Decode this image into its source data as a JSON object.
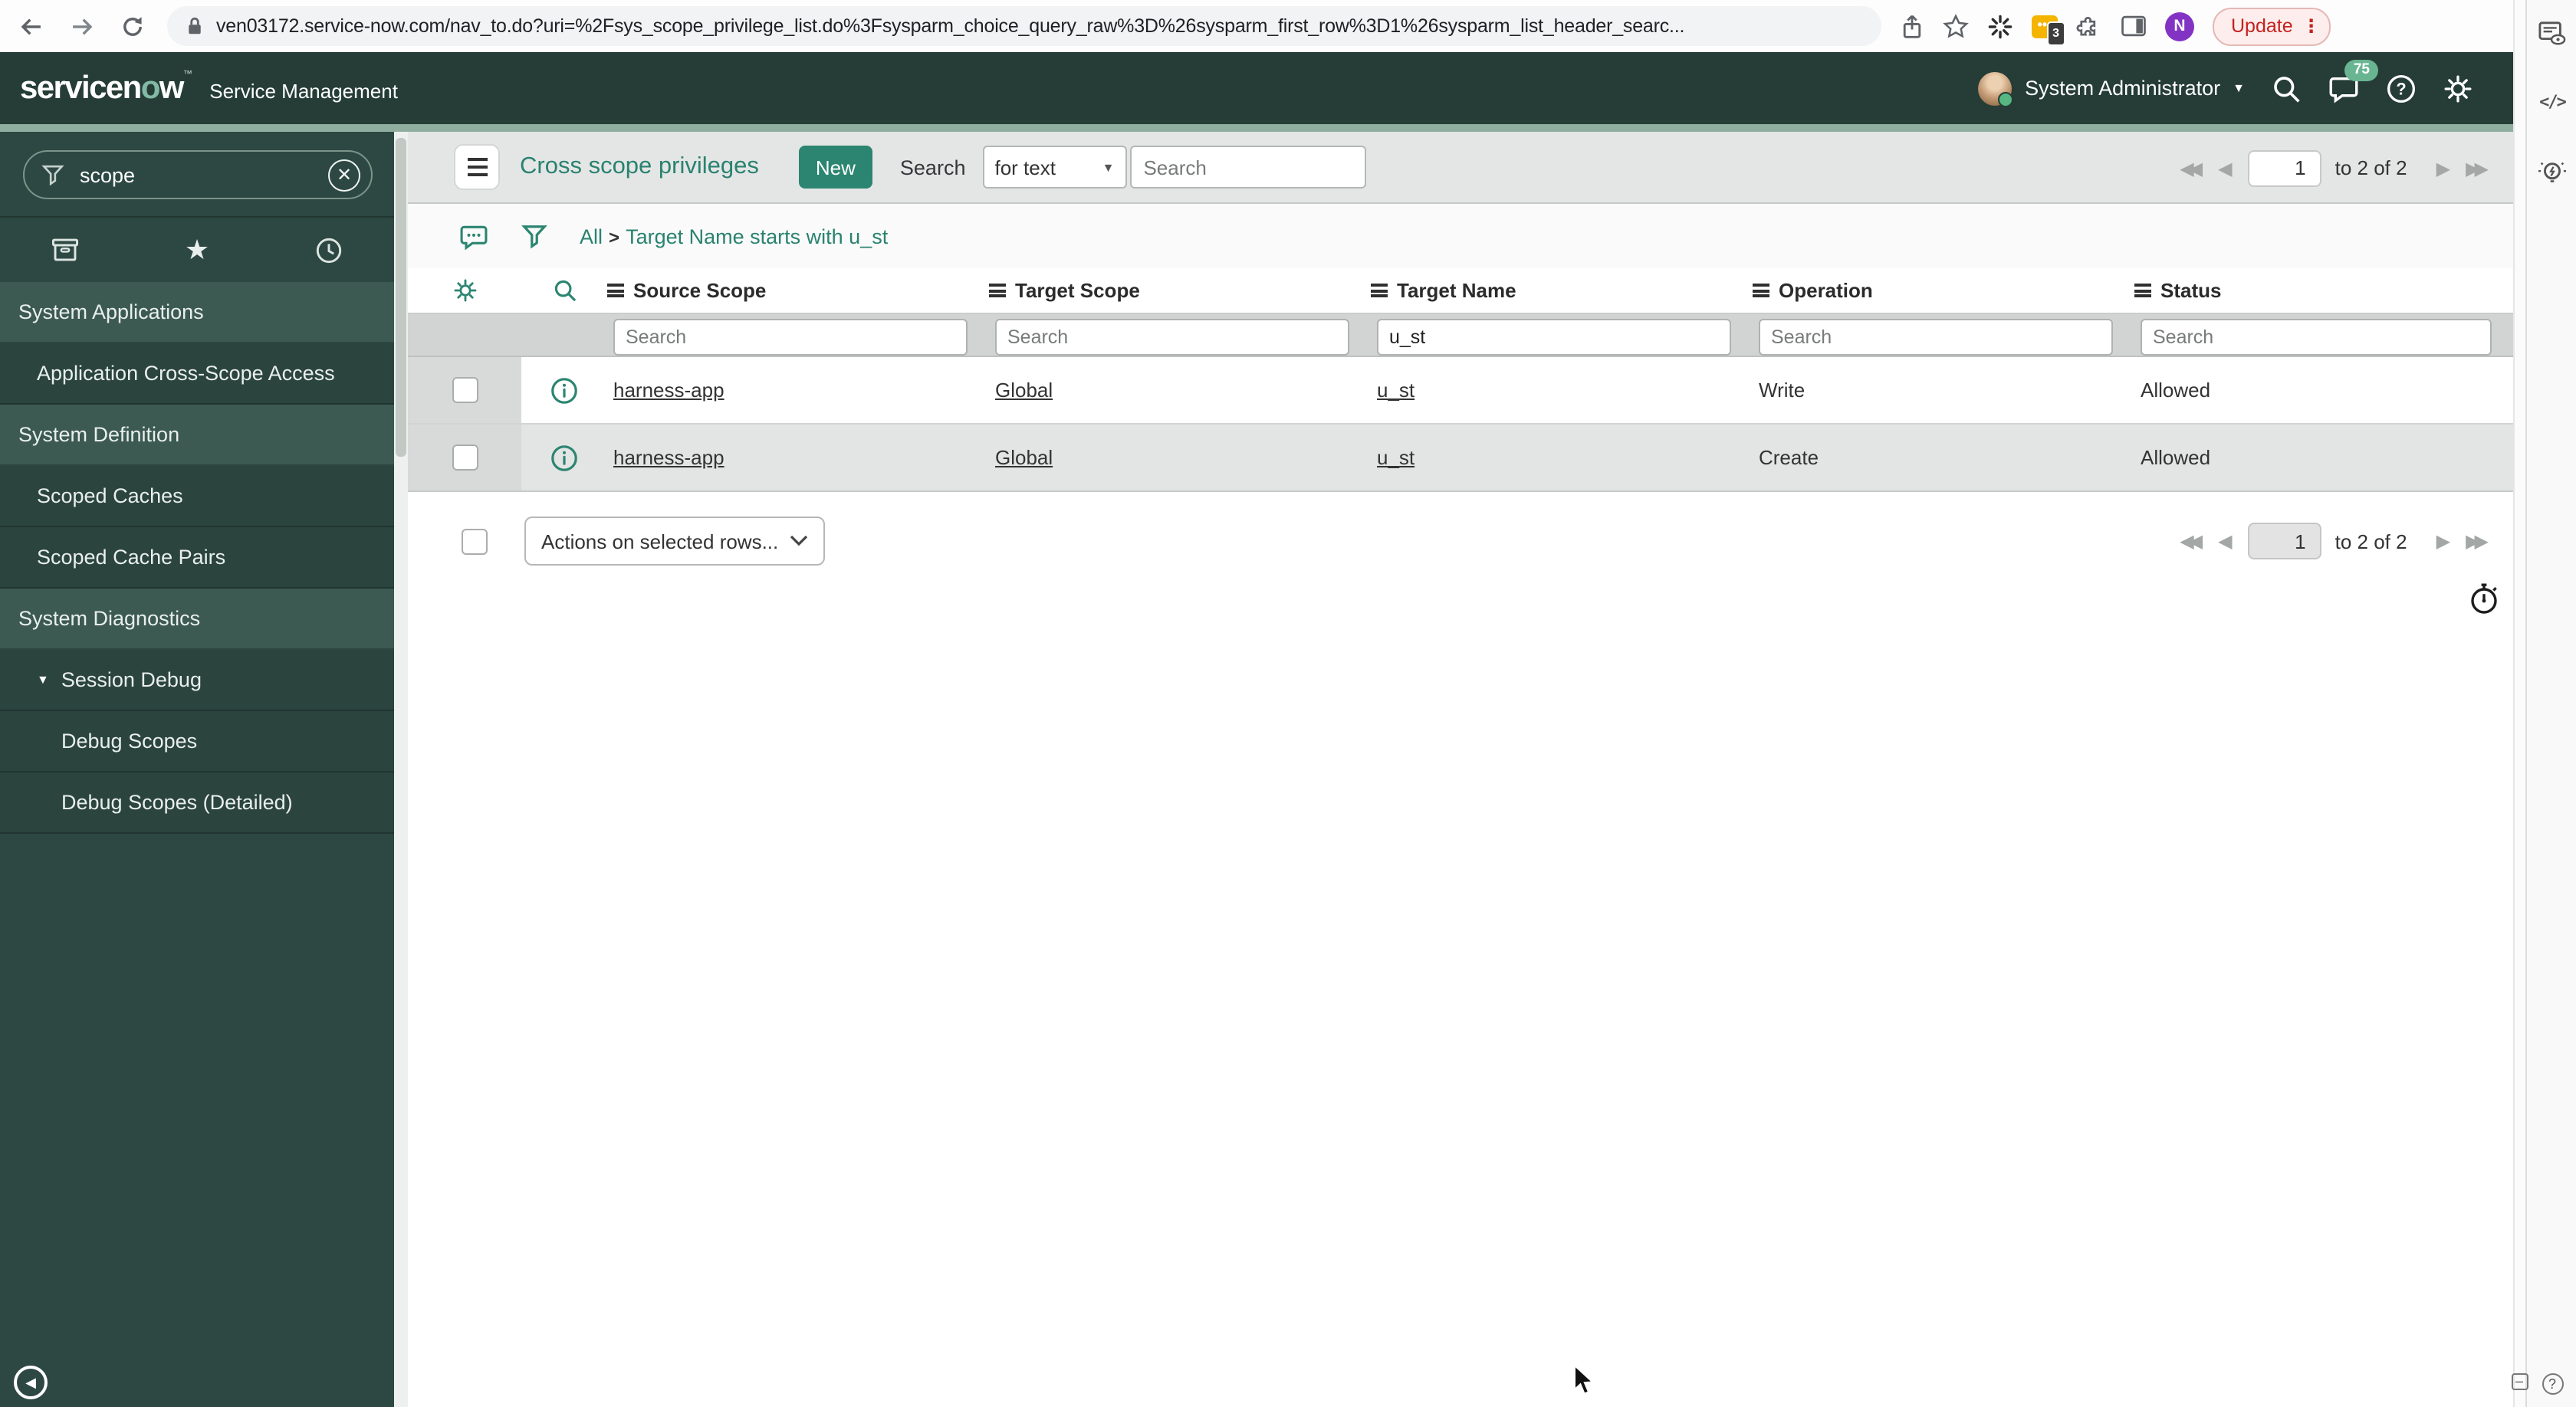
{
  "browser": {
    "url": "ven03172.service-now.com/nav_to.do?uri=%2Fsys_scope_privilege_list.do%3Fsysparm_choice_query_raw%3D%26sysparm_first_row%3D1%26sysparm_list_header_searc...",
    "update_button": "Update",
    "extension_badge": "3",
    "profile_initial": "N"
  },
  "app_header": {
    "logo_prefix": "servicen",
    "logo_o": "o",
    "logo_suffix": "w",
    "logo_tm": "™",
    "product": "Service Management",
    "user": "System Administrator",
    "notification_count": "75"
  },
  "sidebar": {
    "search_value": "scope",
    "items": [
      {
        "label": "System Applications",
        "level": "section"
      },
      {
        "label": "Application Cross-Scope Access",
        "level": "item"
      },
      {
        "label": "System Definition",
        "level": "section"
      },
      {
        "label": "Scoped Caches",
        "level": "item"
      },
      {
        "label": "Scoped Cache Pairs",
        "level": "item"
      },
      {
        "label": "System Diagnostics",
        "level": "section"
      },
      {
        "label": "Session Debug",
        "level": "item-expanded"
      },
      {
        "label": "Debug Scopes",
        "level": "subitem"
      },
      {
        "label": "Debug Scopes (Detailed)",
        "level": "subitem"
      }
    ]
  },
  "list": {
    "title": "Cross scope privileges",
    "new_button": "New",
    "search_label": "Search",
    "search_type": "for text",
    "search_placeholder": "Search",
    "breadcrumb": {
      "all": "All",
      "separator": ">",
      "filter": "Target Name starts with u_st"
    },
    "columns": [
      "Source Scope",
      "Target Scope",
      "Target Name",
      "Operation",
      "Status"
    ],
    "filters": [
      {
        "value": "",
        "placeholder": "Search"
      },
      {
        "value": "",
        "placeholder": "Search"
      },
      {
        "value": "u_st",
        "placeholder": ""
      },
      {
        "value": "",
        "placeholder": "Search"
      },
      {
        "value": "",
        "placeholder": "Search"
      }
    ],
    "rows": [
      {
        "source_scope": "harness-app",
        "target_scope": "Global",
        "target_name": "u_st",
        "operation": "Write",
        "status": "Allowed"
      },
      {
        "source_scope": "harness-app",
        "target_scope": "Global",
        "target_name": "u_st",
        "operation": "Create",
        "status": "Allowed"
      }
    ],
    "actions_dropdown": "Actions on selected rows...",
    "pagination": {
      "page": "1",
      "range_label": "to 2 of 2"
    }
  },
  "colors": {
    "accent_teal": "#2b8571",
    "header_green": "#253d36",
    "sidebar_green": "#2d4842",
    "accent_line": "#8fae9f",
    "badge_green": "#69b592",
    "update_red": "#c5221f",
    "extension_yellow": "#f5b400",
    "avatar_purple": "#8333c4"
  }
}
